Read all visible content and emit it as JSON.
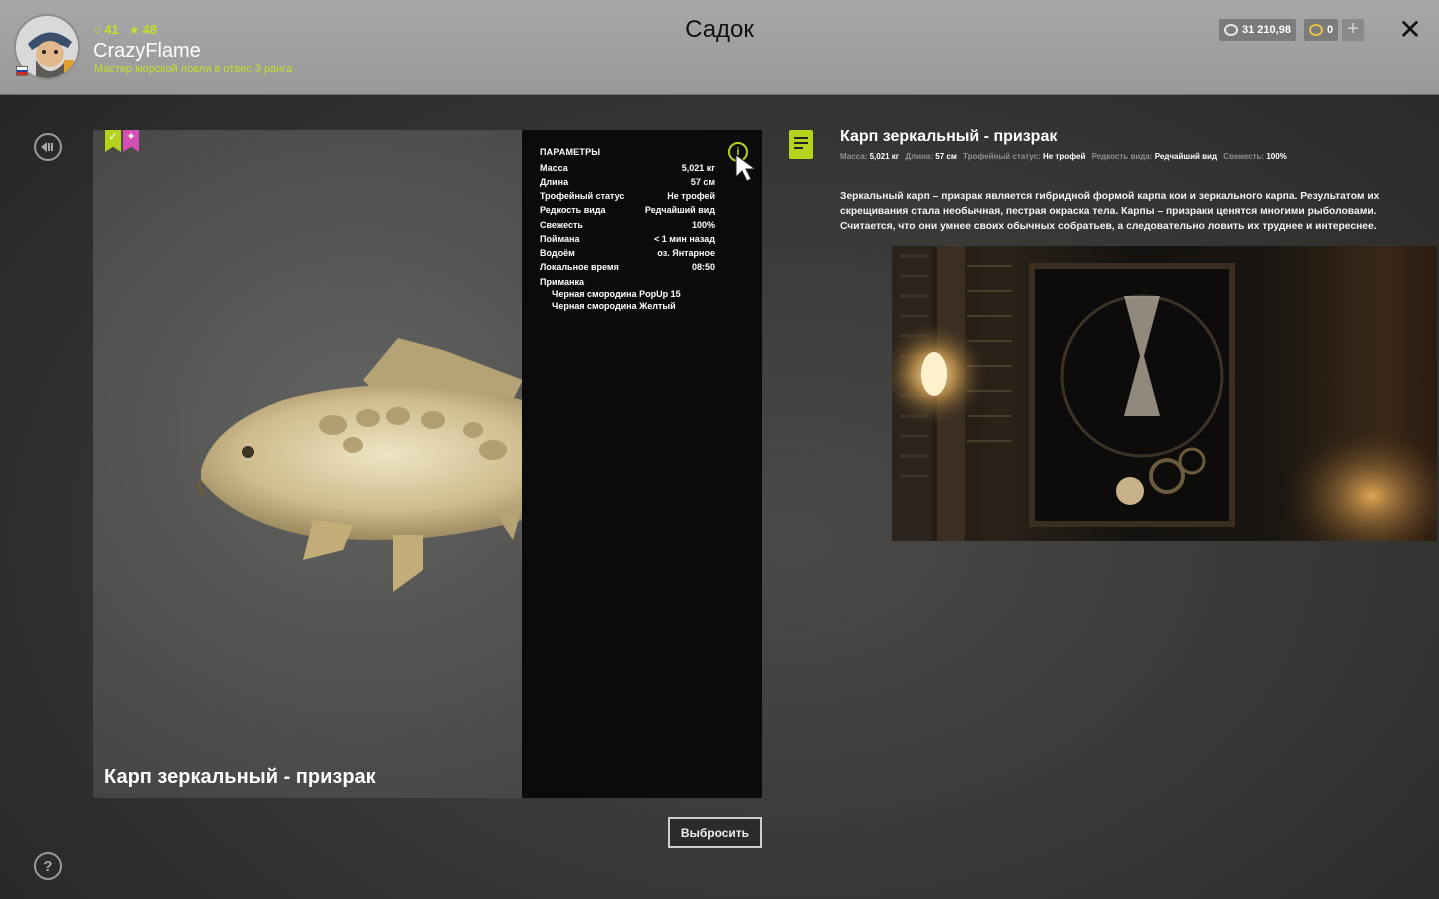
{
  "header": {
    "title": "Садок",
    "player": {
      "name": "CrazyFlame",
      "level": "41",
      "stars": "48",
      "rank": "Мастер морской ловли в отвес 3 ранга"
    },
    "currency": {
      "silver": "31 210,98",
      "gold": "0"
    },
    "plus_label": "+",
    "close_label": "✕"
  },
  "fish": {
    "name": "Карп зеркальный - призрак",
    "params_title": "ПАРАМЕТРЫ",
    "params": [
      {
        "label": "Масса",
        "value": "5,021 кг"
      },
      {
        "label": "Длина",
        "value": "57 см"
      },
      {
        "label": "Трофейный статус",
        "value": "Не трофей"
      },
      {
        "label": "Редкость вида",
        "value": "Редчайший вид"
      },
      {
        "label": "Свежесть",
        "value": "100%"
      },
      {
        "label": "Поймана",
        "value": "< 1 мин назад"
      },
      {
        "label": "Водоём",
        "value": "оз. Янтарное"
      },
      {
        "label": "Локальное время",
        "value": "08:50"
      }
    ],
    "lure_label": "Приманка",
    "lures": [
      "Черная смородина PopUp 15",
      "Черная смородина Желтый"
    ],
    "throw_button": "Выбросить"
  },
  "details": {
    "title": "Карп зеркальный - призрак",
    "summary": [
      {
        "label": "Масса:",
        "value": "5,021 кг"
      },
      {
        "label": "Длина:",
        "value": "57 см"
      },
      {
        "label": "Трофейный статус:",
        "value": "Не трофей"
      },
      {
        "label": "Редкость вида:",
        "value": "Редчайший вид"
      },
      {
        "label": "Свежесть:",
        "value": "100%"
      }
    ],
    "description": "Зеркальный карп – призрак является гибридной формой карпа кои и зеркального карпа. Результатом их скрещивания стала необычная, пестрая окраска тела. Карпы – призраки ценятся многими рыболовами. Считается, что они умнее своих обычных собратьев, а следовательно ловить их труднее и интереснее."
  },
  "colors": {
    "accent": "#b7d21d",
    "header_bg": "#a0a0a0",
    "badge_green": "#b7d21d",
    "badge_pink": "#d34fb4"
  },
  "icons": {
    "back": "back-icon",
    "help": "help-icon",
    "info": "info-icon",
    "description": "document-icon"
  }
}
